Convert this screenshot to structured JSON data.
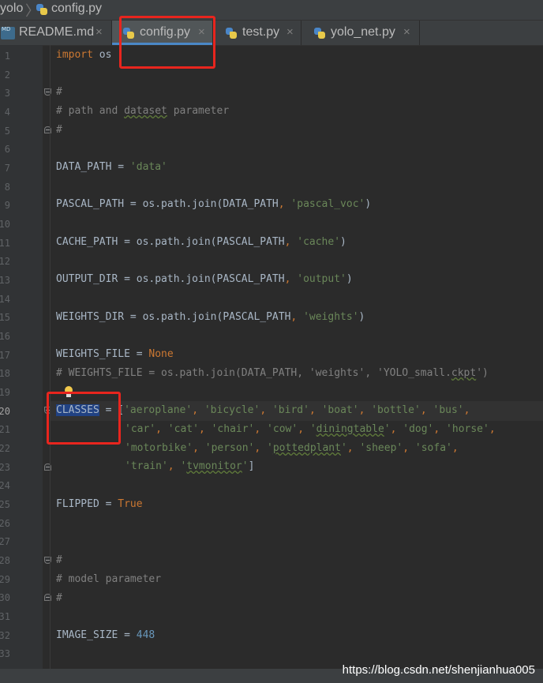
{
  "breadcrumb": {
    "project": "yolo",
    "file": "config.py"
  },
  "tabs": [
    {
      "label": "README.md",
      "close": "×",
      "icon": "markdown-file-icon"
    },
    {
      "label": "config.py",
      "close": "×",
      "icon": "python-file-icon",
      "active": true
    },
    {
      "label": "test.py",
      "close": "×",
      "icon": "python-file-icon"
    },
    {
      "label": "yolo_net.py",
      "close": "×",
      "icon": "python-file-icon"
    }
  ],
  "icons": {
    "markdown": "MD",
    "bulb": "lightbulb-icon"
  },
  "line_numbers": [
    "1",
    "2",
    "3",
    "4",
    "5",
    "6",
    "7",
    "8",
    "9",
    "10",
    "11",
    "12",
    "13",
    "14",
    "15",
    "16",
    "17",
    "18",
    "19",
    "20",
    "21",
    "22",
    "23",
    "24",
    "25",
    "26",
    "27",
    "28",
    "29",
    "30",
    "31",
    "32",
    "33"
  ],
  "code": {
    "l1_kw": "import",
    "l1_mod": " os",
    "l3": "#",
    "l4_a": "# path and ",
    "l4_b": "dataset",
    "l4_c": " parameter",
    "l5": "#",
    "l7_a": "DATA_PATH = ",
    "l7_s": "'data'",
    "l9_a": "PASCAL_PATH = os.path.join(DATA_PATH",
    "l9_c": ", ",
    "l9_s": "'pascal_voc'",
    "l9_e": ")",
    "l11_a": "CACHE_PATH = os.path.join(PASCAL_PATH",
    "l11_c": ", ",
    "l11_s": "'cache'",
    "l11_e": ")",
    "l13_a": "OUTPUT_DIR = os.path.join(PASCAL_PATH",
    "l13_c": ", ",
    "l13_s": "'output'",
    "l13_e": ")",
    "l15_a": "WEIGHTS_DIR = os.path.join(PASCAL_PATH",
    "l15_c": ", ",
    "l15_s": "'weights'",
    "l15_e": ")",
    "l17_a": "WEIGHTS_FILE = ",
    "l17_k": "None",
    "l18_a": "# WEIGHTS_FILE = os.path.join(DATA_PATH, 'weights', 'YOLO_small.",
    "l18_b": "ckpt",
    "l18_c": "')",
    "l20_sel": "CLASSES",
    "l20_a": " = [",
    "l20_i1": "'aeroplane'",
    "l20_i2": "'bicycle'",
    "l20_i3": "'bird'",
    "l20_i4": "'boat'",
    "l20_i5": "'bottle'",
    "l20_i6": "'bus'",
    "l21_i1": "'car'",
    "l21_i2": "'cat'",
    "l21_i3": "'chair'",
    "l21_i4": "'cow'",
    "l21_i5q": "'",
    "l21_i5": "diningtable",
    "l21_i5e": "'",
    "l21_i6": "'dog'",
    "l21_i7": "'horse'",
    "l22_i1": "'motorbike'",
    "l22_i2": "'person'",
    "l22_i3q": "'",
    "l22_i3": "pottedplant",
    "l22_i3e": "'",
    "l22_i4": "'sheep'",
    "l22_i5": "'sofa'",
    "l23_i1": "'train'",
    "l23_i2q": "'",
    "l23_i2": "tvmonitor",
    "l23_i2e": "'",
    "l23_e": "]",
    "comma": ", ",
    "l25_a": "FLIPPED = ",
    "l25_k": "True",
    "l28": "#",
    "l29": "# model parameter",
    "l30": "#",
    "l32_a": "IMAGE_SIZE = ",
    "l32_n": "448"
  },
  "colors": {
    "keyword": "#cc7832",
    "string": "#6a8759",
    "comment": "#808080",
    "number": "#6897bb",
    "highlight_box": "#e8251e"
  },
  "watermark": "https://blog.csdn.net/shenjianhua005"
}
